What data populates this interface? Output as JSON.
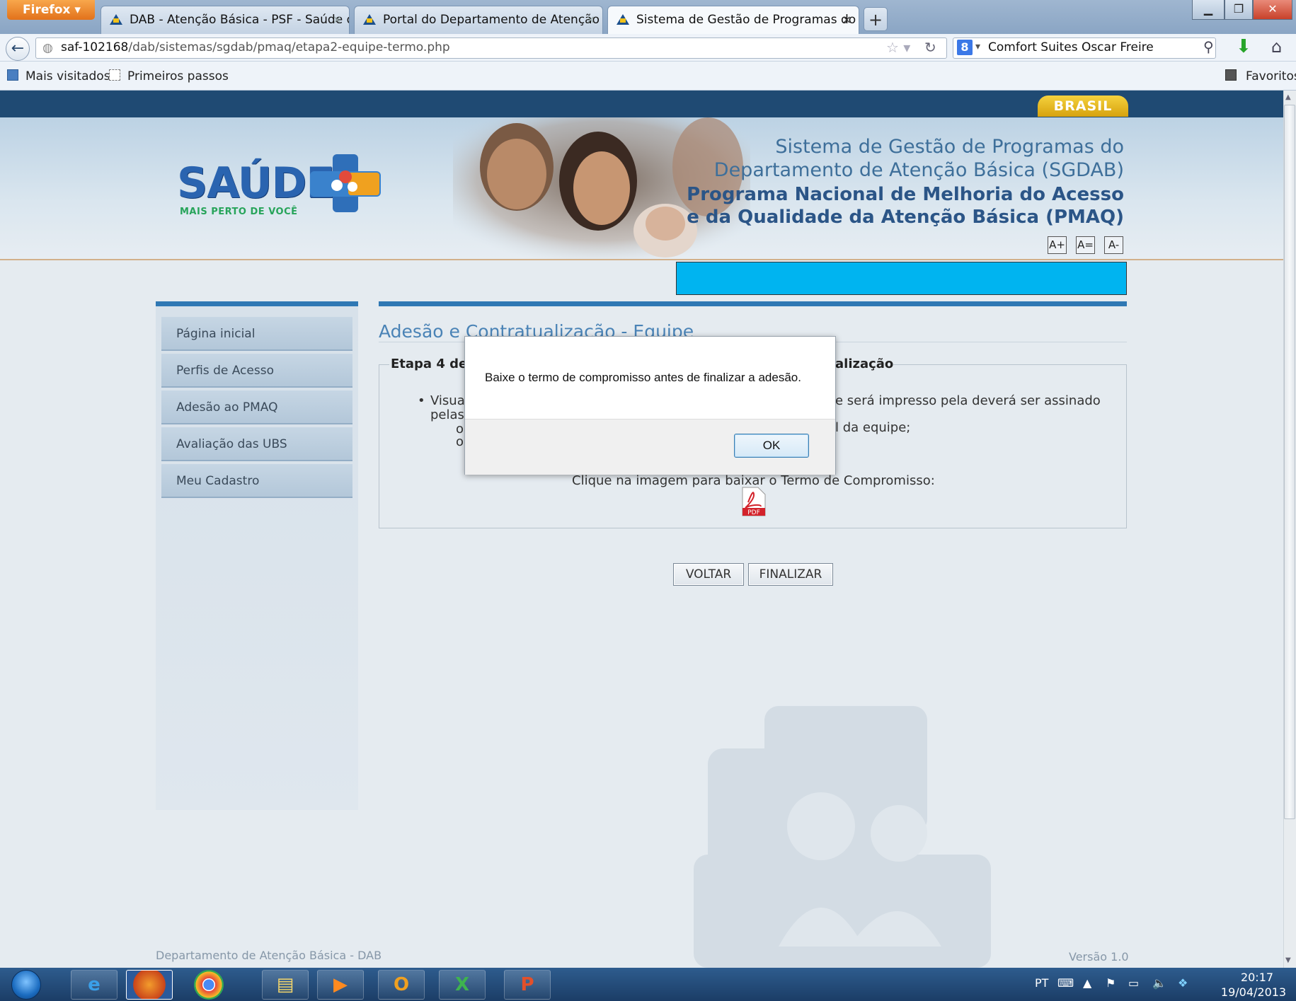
{
  "browser": {
    "menu_label": "Firefox",
    "tabs": [
      {
        "label": "DAB - Atenção Básica - PSF - Saúde d...",
        "active": false
      },
      {
        "label": "Portal do Departamento de Atenção ...",
        "active": false
      },
      {
        "label": "Sistema de Gestão de Programas do ...",
        "active": true
      }
    ],
    "tab_close": "×",
    "new_tab": "+",
    "url_host": "saf-102168",
    "url_path": "/dab/sistemas/sgdab/pmaq/etapa2-equipe-termo.php",
    "search_engine_letter": "8",
    "search_value": "Comfort Suites Oscar Freire",
    "bookmarks": [
      "Mais visitados",
      "Primeiros passos"
    ],
    "favorites_label": "Favoritos"
  },
  "site": {
    "brasil_badge": "BRASIL",
    "logo_text": "SAÚDE",
    "logo_subtext": "MAIS PERTO DE VOCÊ",
    "system_title_line1": "Sistema de Gestão de Programas do",
    "system_title_line2": "Departamento de Atenção Básica (SGDAB)",
    "program_title_line1": "Programa Nacional de Melhoria do Acesso",
    "program_title_line2": "e da Qualidade da Atenção Básica (PMAQ)",
    "font_buttons": [
      "A+",
      "A=",
      "A-"
    ]
  },
  "sidebar": {
    "items": [
      "Página inicial",
      "Perfis de Acesso",
      "Adesão ao PMAQ",
      "Avaliação das UBS",
      "Meu Cadastro"
    ]
  },
  "main": {
    "title": "Adesão e Contratualização - Equipe",
    "step_legend_left": "Etapa 4 de",
    "step_legend_right": "alização",
    "bullet_start": "Visua",
    "bullet_right": "e será impresso pela deverá ser assinado",
    "bullet_line2": "pelas",
    "sub1_right": "l da equipe;",
    "download_prompt": "Clique na imagem para baixar o Termo de Compromisso:",
    "pdf_label": "PDF",
    "back_button": "VOLTAR",
    "finish_button": "FINALIZAR"
  },
  "footer": {
    "left": "Departamento de Atenção Básica - DAB",
    "right": "Versão 1.0"
  },
  "dialog": {
    "message": "Baixe o termo de compromisso antes de finalizar a adesão.",
    "ok_label": "OK"
  },
  "taskbar": {
    "language": "PT",
    "time": "20:17",
    "date": "19/04/2013"
  },
  "colors": {
    "accent_blue": "#2f78b4",
    "highlight_cyan": "#00b4f0",
    "brasil_yellow": "#f5d23e"
  }
}
